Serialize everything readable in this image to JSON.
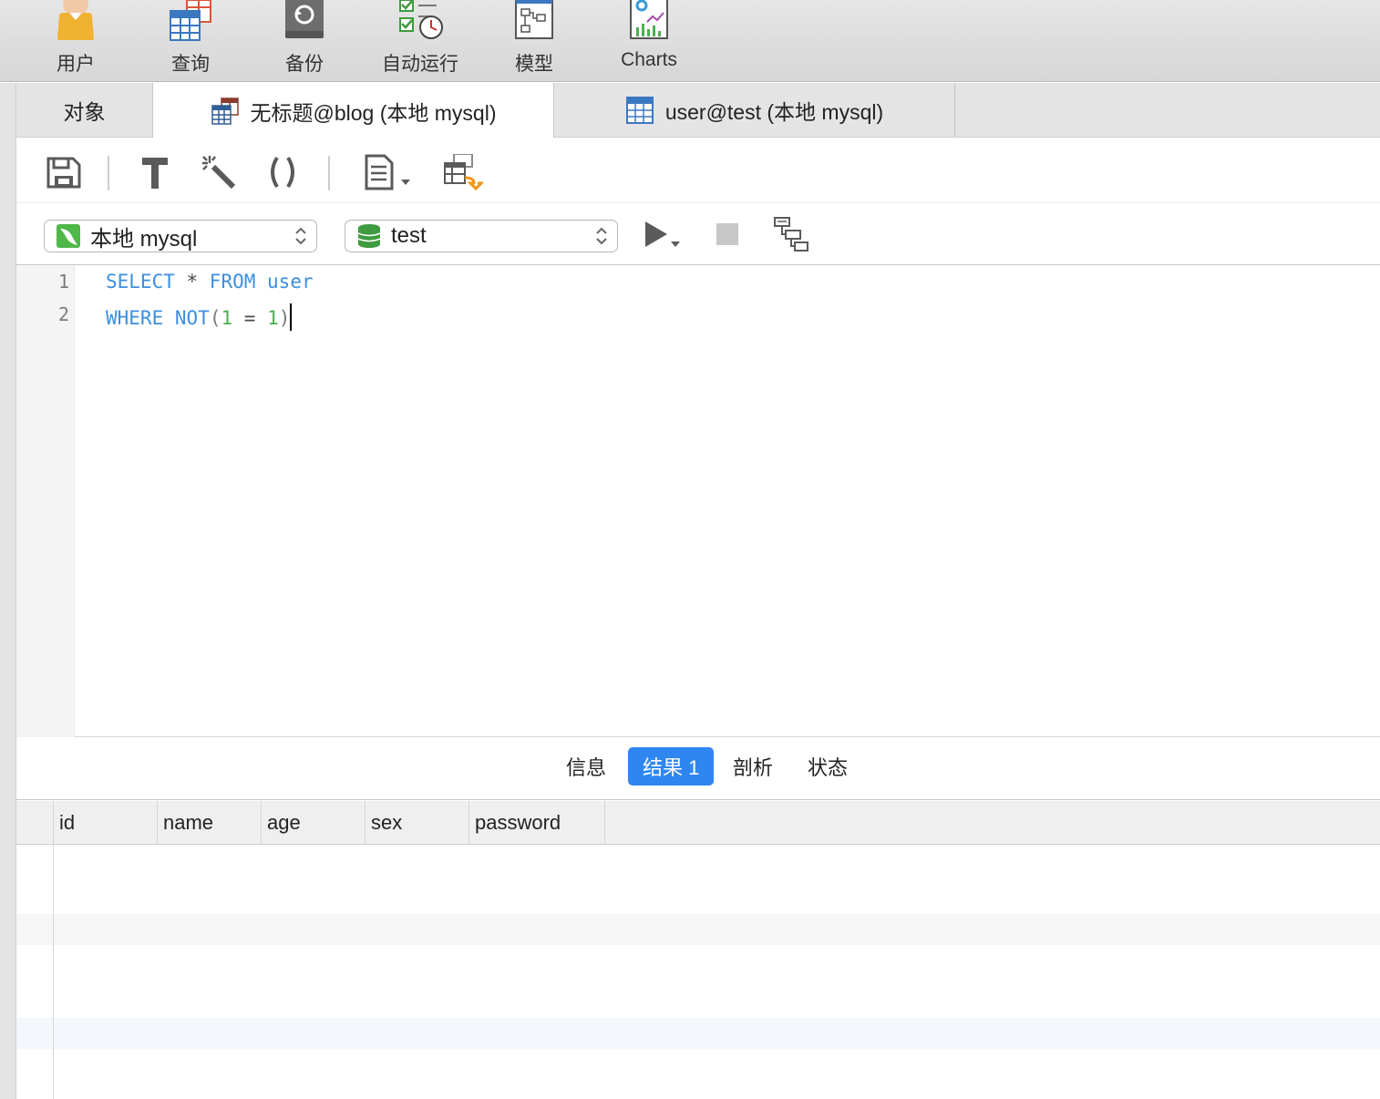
{
  "toolbar": {
    "items": [
      {
        "label": "用户",
        "icon": "user-icon"
      },
      {
        "label": "查询",
        "icon": "query-icon"
      },
      {
        "label": "备份",
        "icon": "backup-icon"
      },
      {
        "label": "自动运行",
        "icon": "automation-icon"
      },
      {
        "label": "模型",
        "icon": "model-icon"
      },
      {
        "label": "Charts",
        "icon": "charts-icon"
      }
    ]
  },
  "tabs": [
    {
      "label": "对象",
      "active": false
    },
    {
      "label": "无标题@blog (本地 mysql)",
      "active": true,
      "icon": "query-tab-icon"
    },
    {
      "label": "user@test (本地 mysql)",
      "active": false,
      "icon": "table-tab-icon"
    }
  ],
  "editor_toolbar": {
    "icons": [
      "save-icon",
      "format-hammer-icon",
      "beautify-wand-icon",
      "parentheses-icon",
      "snippet-icon",
      "export-result-icon"
    ]
  },
  "connection": {
    "server": "本地 mysql",
    "database": "test"
  },
  "editor": {
    "line_numbers": [
      "1",
      "2"
    ],
    "line1": {
      "kw1": "SELECT",
      "star": " * ",
      "kw2": "FROM",
      "sp": " ",
      "ident": "user"
    },
    "line2": {
      "kw1": "WHERE",
      "sp": " ",
      "kw2": "NOT",
      "open": "(",
      "n1": "1",
      "eq": " = ",
      "n2": "1",
      "close": ")"
    }
  },
  "result_tabs": [
    {
      "label": "信息",
      "active": false
    },
    {
      "label": "结果 1",
      "active": true
    },
    {
      "label": "剖析",
      "active": false
    },
    {
      "label": "状态",
      "active": false
    }
  ],
  "grid": {
    "columns": [
      "id",
      "name",
      "age",
      "sex",
      "password"
    ],
    "rows": []
  },
  "colors": {
    "accent": "#2f86f0",
    "keyword": "#3d8fe0",
    "number": "#4caf50"
  }
}
